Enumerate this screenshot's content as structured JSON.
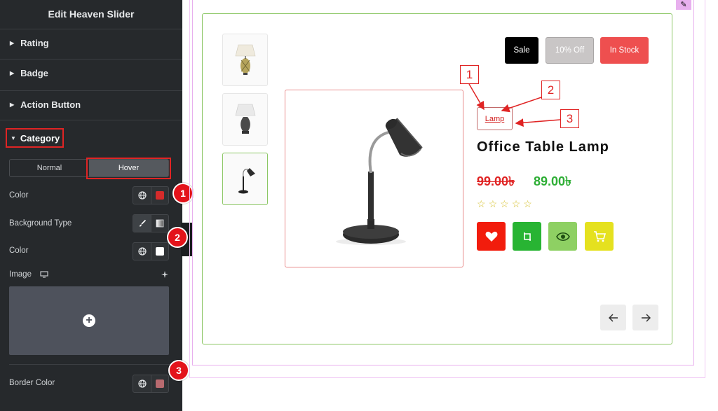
{
  "panel": {
    "title": "Edit Heaven Slider",
    "sections": [
      {
        "label": "Rating"
      },
      {
        "label": "Badge"
      },
      {
        "label": "Action Button"
      },
      {
        "label": "Category"
      }
    ],
    "tabs": {
      "normal": "Normal",
      "hover": "Hover",
      "active": "Hover"
    },
    "rows": {
      "color": "Color",
      "background_type": "Background Type",
      "color2": "Color",
      "image": "Image",
      "border_color": "Border Color"
    },
    "swatches": {
      "color": "#d52b2b",
      "bg_color": "#ffffff",
      "border_color": "#b86a6f"
    }
  },
  "markers": [
    "1",
    "2",
    "3"
  ],
  "preview": {
    "badges": [
      {
        "label": "Sale",
        "bg": "#000000"
      },
      {
        "label": "10% Off",
        "bg": "#c9c6c6"
      },
      {
        "label": "In Stock",
        "bg": "#ee4f4f"
      }
    ],
    "category": "Lamp",
    "product_title": "Office Table Lamp",
    "old_price": "99.00৳",
    "new_price": "89.00৳",
    "rating": {
      "filled": 0,
      "total": 5
    },
    "action_buttons": [
      {
        "icon": "heart-icon",
        "bg": "#f21c0c"
      },
      {
        "icon": "compare-icon",
        "bg": "#28b433"
      },
      {
        "icon": "eye-icon",
        "bg": "#8ed063"
      },
      {
        "icon": "cart-icon",
        "bg": "#e5e11f"
      }
    ],
    "thumbnails": [
      "lamp-thumb-1",
      "lamp-thumb-2",
      "lamp-thumb-3"
    ],
    "callouts": [
      "1",
      "2",
      "3"
    ]
  }
}
